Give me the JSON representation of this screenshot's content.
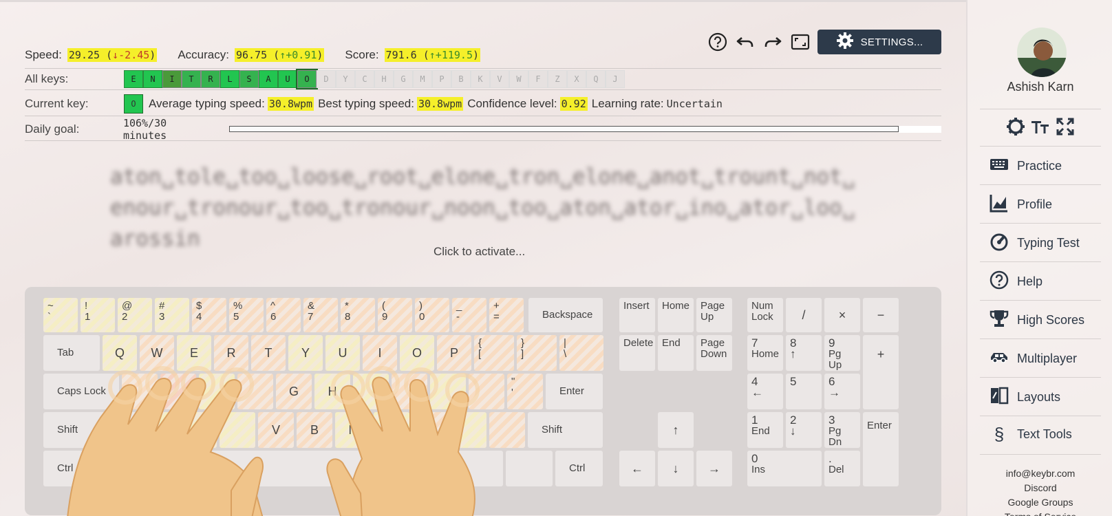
{
  "toolbar": {
    "settings_label": "SETTINGS..."
  },
  "stats": {
    "speed_label": "Speed:",
    "speed_value": "29.25",
    "speed_delta": "↓-2.45",
    "accuracy_label": "Accuracy:",
    "accuracy_value": "96.75",
    "accuracy_delta": "↑+0.91",
    "score_label": "Score:",
    "score_value": "791.6",
    "score_delta": "↑+119.5"
  },
  "all_keys": {
    "label": "All keys:",
    "keys": [
      "E",
      "N",
      "I",
      "T",
      "R",
      "L",
      "S",
      "A",
      "U",
      "O",
      "D",
      "Y",
      "C",
      "H",
      "G",
      "M",
      "P",
      "B",
      "K",
      "V",
      "W",
      "F",
      "Z",
      "X",
      "Q",
      "J"
    ]
  },
  "current": {
    "label": "Current key:",
    "key": "O",
    "avg_label": "Average typing speed:",
    "avg_value": "30.8wpm",
    "best_label": "Best typing speed:",
    "best_value": "30.8wpm",
    "conf_label": "Confidence level:",
    "conf_value": "0.92",
    "rate_label": "Learning rate:",
    "rate_value": "Uncertain"
  },
  "goal": {
    "label": "Daily goal:",
    "value": "106%/30 minutes",
    "progress": 1.0
  },
  "lesson_text": [
    "aton␣tole␣too␣loose␣root␣elone␣tron␣elone␣anot␣trount␣not␣",
    "enour␣tronour␣too␣tronour␣noon␣too␣aton␣ator␣ino␣ator␣loo␣",
    "arossin"
  ],
  "activate_text": "Click to activate...",
  "keyboard": {
    "row1": [
      [
        "~",
        "`"
      ],
      [
        "!",
        "1"
      ],
      [
        "@",
        "2"
      ],
      [
        "#",
        "3"
      ],
      [
        "$",
        "4"
      ],
      [
        "%",
        "5"
      ],
      [
        "^",
        "6"
      ],
      [
        "&",
        "7"
      ],
      [
        "*",
        "8"
      ],
      [
        "(",
        "9"
      ],
      [
        ")",
        "0"
      ],
      [
        "_",
        "-"
      ],
      [
        "+",
        "="
      ]
    ],
    "backspace": "Backspace",
    "tab": "Tab",
    "row2": [
      "Q",
      "W",
      "E",
      "R",
      "T",
      "Y",
      "U",
      "I",
      "O",
      "P"
    ],
    "row2_sym": [
      [
        "{",
        "["
      ],
      [
        "}",
        "]"
      ],
      [
        "|",
        "\\"
      ]
    ],
    "caps": "Caps Lock",
    "row3_visible": [
      "G",
      "H"
    ],
    "row3_sym": [
      "\"",
      "'"
    ],
    "enter": "Enter",
    "shift": "Shift",
    "row4_visible": [
      "X",
      "V",
      "B",
      "N"
    ],
    "ctrl": "Ctrl",
    "nav": {
      "insert": "Insert",
      "home": "Home",
      "page_up": "Page Up",
      "delete": "Delete",
      "end": "End",
      "page_down": "Page Down"
    },
    "arrows": {
      "up": "↑",
      "left": "←",
      "down": "↓",
      "right": "→"
    },
    "numpad": {
      "numlock": "Num Lock",
      "slash": "/",
      "mult": "×",
      "minus": "−",
      "plus": "+",
      "enter": "Enter",
      "n7": [
        "7",
        "Home"
      ],
      "n8": [
        "8",
        "↑"
      ],
      "n9": [
        "9",
        "Pg Up"
      ],
      "n4": [
        "4",
        "←"
      ],
      "n5": [
        "5",
        ""
      ],
      "n6": [
        "6",
        "→"
      ],
      "n1": [
        "1",
        "End"
      ],
      "n2": [
        "2",
        "↓"
      ],
      "n3": [
        "3",
        "Pg Dn"
      ],
      "n0": [
        "0",
        "Ins"
      ],
      "ndot": [
        ".",
        "Del"
      ]
    }
  },
  "sidebar": {
    "username": "Ashish Karn",
    "nav": [
      "Practice",
      "Profile",
      "Typing Test",
      "Help",
      "High Scores",
      "Multiplayer",
      "Layouts",
      "Text Tools"
    ],
    "links": [
      "info@keybr.com",
      "Discord",
      "Google Groups",
      "Terms of Service"
    ]
  }
}
